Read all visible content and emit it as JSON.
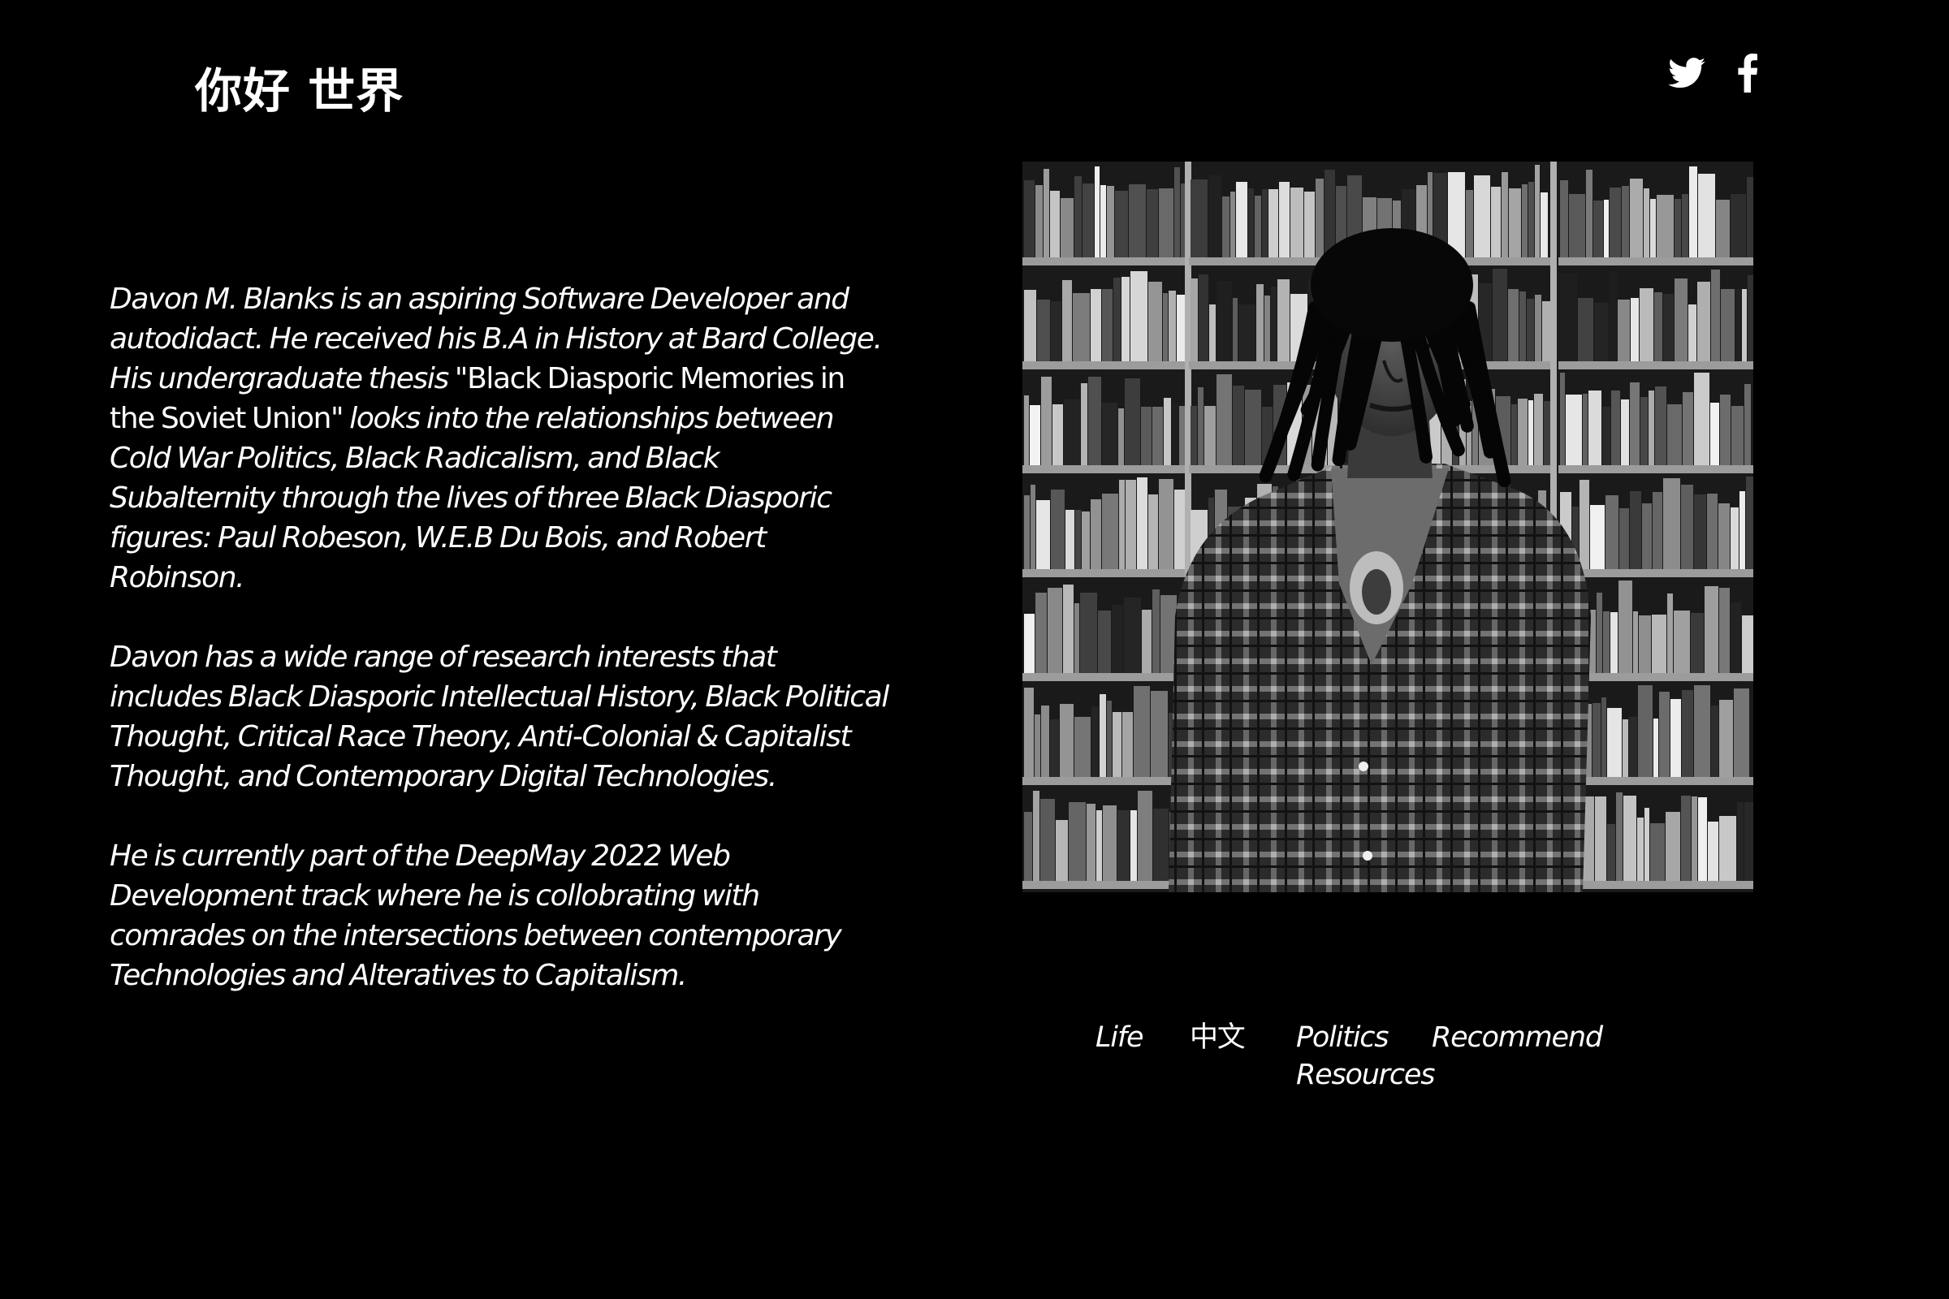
{
  "header": {
    "title": "你好 世界"
  },
  "social": {
    "icons": [
      "twitter-icon",
      "facebook-icon"
    ]
  },
  "bio": {
    "p1_before": "Davon M. Blanks is an aspiring Software Developer and autodidact. He received his B.A in History at Bard College. His undergraduate thesis ",
    "p1_thesis": "\"Black Diasporic Memories in the Soviet Union\"",
    "p1_after": " looks into the relationships between Cold War Politics, Black Radicalism, and Black Subalternity through the lives of three Black Diasporic figures: Paul Robeson, W.E.B Du Bois, and Robert Robinson.",
    "p2": "Davon has a wide range of research interests that includes Black Diasporic Intellectual History, Black Political Thought, Critical Race Theory, Anti-Colonial & Capitalist Thought, and Contemporary Digital Technologies.",
    "p3": "He is currently part of the DeepMay 2022 Web Development track where he is collobrating with comrades on the intersections between contemporary Technologies and Alteratives to Capitalism."
  },
  "nav": {
    "life": "Life",
    "chinese": "中文",
    "politics": "Politics",
    "recommend": "Recommend",
    "resources": "Resources"
  },
  "colors": {
    "background": "#000000",
    "text": "#ffffff"
  }
}
